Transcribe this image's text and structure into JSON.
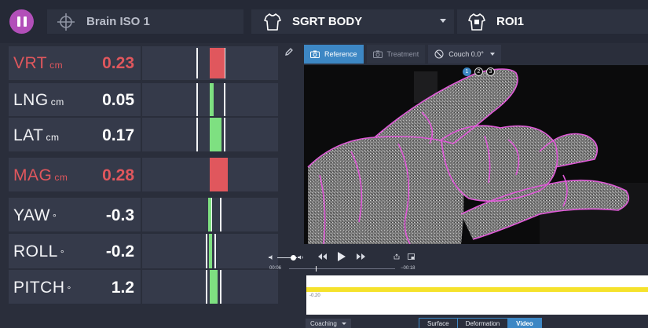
{
  "header": {
    "isocenter_label": "Brain ISO 1",
    "surface_label": "SGRT BODY",
    "roi_label": "ROI1"
  },
  "metrics": [
    {
      "name": "VRT",
      "unit": "cm",
      "value": "0.23",
      "alert": true
    },
    {
      "name": "LNG",
      "unit": "cm",
      "value": "0.05",
      "alert": false
    },
    {
      "name": "LAT",
      "unit": "cm",
      "value": "0.17",
      "alert": false
    },
    {
      "name": "MAG",
      "unit": "cm",
      "value": "0.28",
      "alert": true
    },
    {
      "name": "YAW",
      "unit": "°",
      "value": "-0.3",
      "alert": false
    },
    {
      "name": "ROLL",
      "unit": "°",
      "value": "-0.2",
      "alert": false
    },
    {
      "name": "PITCH",
      "unit": "°",
      "value": "1.2",
      "alert": false
    }
  ],
  "colors": {
    "alert": "#e0575d",
    "ok": "#7ee081",
    "accent": "#3d87c4",
    "pause": "#b24fb9",
    "contour": "#e05ad8"
  },
  "view_tabs": {
    "reference": "Reference",
    "treatment": "Treatment",
    "couch": "Couch 0.0°"
  },
  "camera_badges": [
    "1",
    "2",
    "3"
  ],
  "playback": {
    "time_start": "00:06",
    "time_end": "−00:18"
  },
  "graph": {
    "label": "-0.20"
  },
  "bottom": {
    "coaching": "Coaching",
    "tabs": [
      "Surface",
      "Deformation",
      "Video"
    ],
    "active_tab": "Video"
  }
}
